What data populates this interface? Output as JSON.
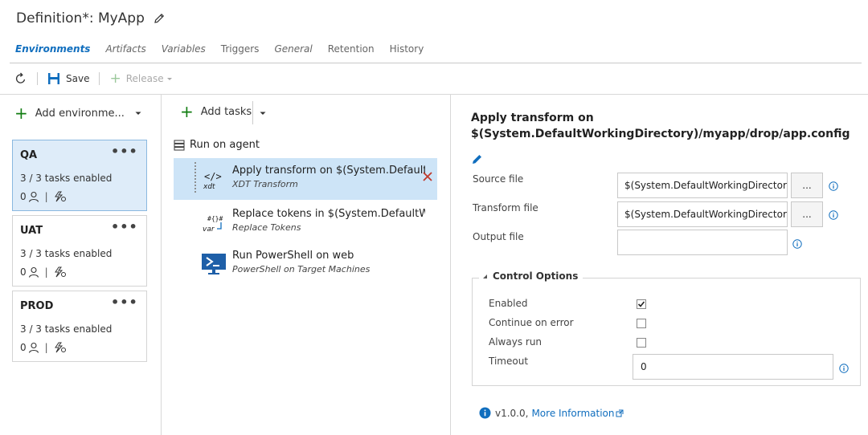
{
  "header": {
    "title": "Definition*: MyApp",
    "tabs": [
      {
        "label": "Environments",
        "active": true
      },
      {
        "label": "Artifacts"
      },
      {
        "label": "Variables"
      },
      {
        "label": "Triggers"
      },
      {
        "label": "General"
      },
      {
        "label": "Retention"
      },
      {
        "label": "History"
      }
    ]
  },
  "toolbar": {
    "refresh_icon": "refresh-icon",
    "save_label": "Save",
    "release_label": "Release"
  },
  "environments": {
    "add_label": "Add environme...",
    "items": [
      {
        "name": "QA",
        "tasks": "3 / 3 tasks enabled",
        "approvers": "0",
        "selected": true
      },
      {
        "name": "UAT",
        "tasks": "3 / 3 tasks enabled",
        "approvers": "0"
      },
      {
        "name": "PROD",
        "tasks": "3 / 3 tasks enabled",
        "approvers": "0"
      }
    ]
  },
  "tasks": {
    "add_label": "Add tasks",
    "phase_label": "Run on agent",
    "items": [
      {
        "name": "Apply transform on $(System.DefaultW",
        "sub": "XDT Transform",
        "icon": "xdt-icon",
        "selected": true
      },
      {
        "name": "Replace tokens in $(System.DefaultWor",
        "sub": "Replace Tokens",
        "icon": "var-icon"
      },
      {
        "name": "Run PowerShell on web",
        "sub": "PowerShell on Target Machines",
        "icon": "powershell-icon"
      }
    ]
  },
  "detail": {
    "title": "Apply transform on $(System.DefaultWorkingDirectory)/myapp/drop/app.config",
    "fields": {
      "source_label": "Source file",
      "source_value": "$(System.DefaultWorkingDirectory)",
      "transform_label": "Transform file",
      "transform_value": "$(System.DefaultWorkingDirectory)",
      "output_label": "Output file",
      "output_value": "",
      "browse_label": "..."
    },
    "control_options": {
      "title": "Control Options",
      "enabled_label": "Enabled",
      "enabled": true,
      "continue_label": "Continue on error",
      "continue": false,
      "always_label": "Always run",
      "always": false,
      "timeout_label": "Timeout",
      "timeout_value": "0"
    },
    "version": "v1.0.0,",
    "more_info": "More Information"
  },
  "colors": {
    "accent": "#106ebe",
    "selected_bg": "#deecf9",
    "delete_red": "#c0392b"
  }
}
